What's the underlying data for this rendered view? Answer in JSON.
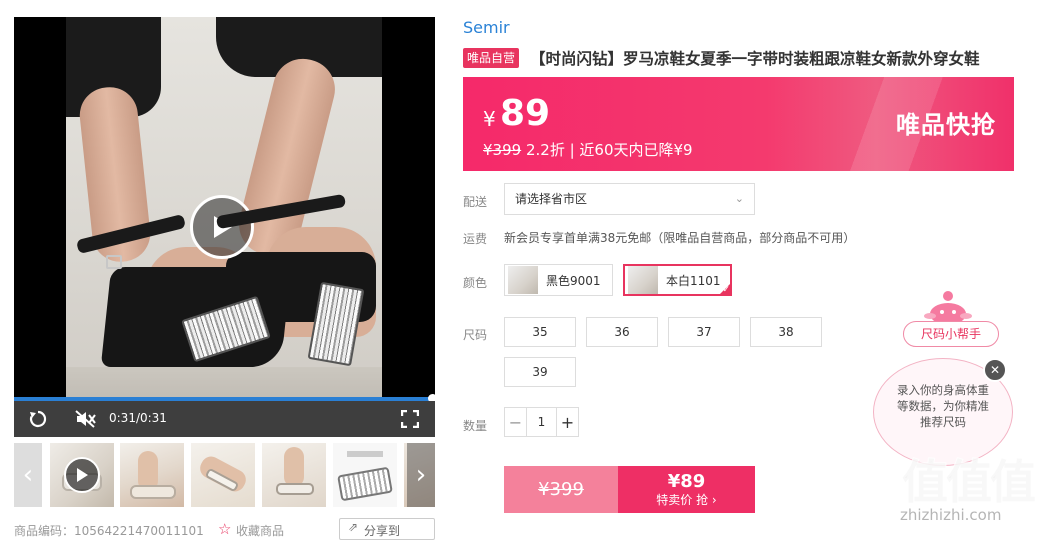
{
  "video": {
    "time": "0:31/0:31",
    "icons": {
      "replay": "replay-icon",
      "mute": "mute-icon",
      "fullscreen": "fullscreen-icon",
      "play": "play-icon"
    }
  },
  "thumbnails": {
    "count": 5,
    "prev": "‹",
    "next": "›"
  },
  "bottom": {
    "code": "商品编码：10564221470011101",
    "favorite": "收藏商品",
    "share": "分享到"
  },
  "product": {
    "brand": "Semir",
    "self_badge": "唯品自营",
    "title": "【时尚闪钻】罗马凉鞋女夏季一字带时装粗跟凉鞋女新款外穿女鞋"
  },
  "price_banner": {
    "currency": "¥",
    "price": "89",
    "original": "¥399",
    "discount": "2.2折",
    "separator": " | ",
    "drop_note": "近60天内已降¥9",
    "flash_label": "唯品快抢",
    "colors": {
      "start": "#f5296a",
      "end": "#f0306a"
    }
  },
  "shipping": {
    "label": "配送",
    "select_value": "请选择省市区",
    "chevron": "⌄"
  },
  "freight": {
    "label": "运费",
    "text": "新会员专享首单满38元免邮（限唯品自营商品，部分商品不可用）"
  },
  "color": {
    "label": "颜色",
    "options": [
      {
        "name": "黑色9001",
        "selected": false
      },
      {
        "name": "本白1101",
        "selected": true
      }
    ]
  },
  "size": {
    "label": "尺码",
    "options": [
      "35",
      "36",
      "37",
      "38",
      "39"
    ]
  },
  "quantity": {
    "label": "数量",
    "value": "1",
    "minus": "−",
    "plus": "+"
  },
  "buy": {
    "original": "¥399",
    "price": "¥89",
    "action": "特卖价 抢",
    "arrow": "›"
  },
  "size_helper": {
    "bubble": "尺码小帮手",
    "tip": "录入你的身高体重等数据，为你精准推荐尺码",
    "close": "✕"
  },
  "watermark": {
    "cn": "值值值",
    "en": "zhizhizhi.com"
  },
  "accent": "#e8345f"
}
